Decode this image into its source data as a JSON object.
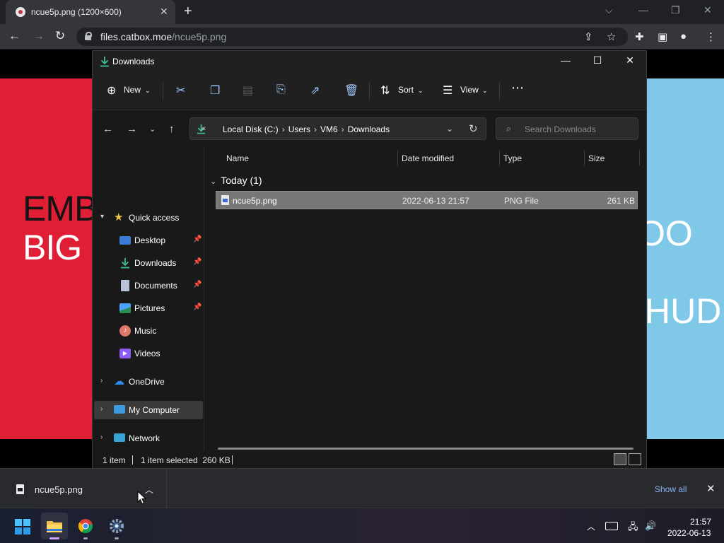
{
  "browser": {
    "tab_title": "ncue5p.png (1200×600)",
    "url_host": "files.catbox.moe",
    "url_path": "/ncue5p.png"
  },
  "page_image": {
    "left_line1": "EMB",
    "left_line2": "BIG",
    "right_line1": "OO",
    "right_line2": "HUD"
  },
  "explorer": {
    "title": "Downloads",
    "commands": {
      "new": "New",
      "sort": "Sort",
      "view": "View"
    },
    "breadcrumb": [
      "Local Disk (C:)",
      "Users",
      "VM6",
      "Downloads"
    ],
    "search_placeholder": "Search Downloads",
    "nav": {
      "quick_access": "Quick access",
      "desktop": "Desktop",
      "downloads": "Downloads",
      "documents": "Documents",
      "pictures": "Pictures",
      "music": "Music",
      "videos": "Videos",
      "onedrive": "OneDrive",
      "my_computer": "My Computer",
      "network": "Network"
    },
    "columns": {
      "name": "Name",
      "date": "Date modified",
      "type": "Type",
      "size": "Size"
    },
    "group": "Today (1)",
    "files": [
      {
        "name": "ncue5p.png",
        "date": "2022-06-13 21:57",
        "type": "PNG File",
        "size": "261 KB"
      }
    ],
    "status": {
      "count": "1 item",
      "selection": "1 item selected  260 KB"
    }
  },
  "download_shelf": {
    "file": "ncue5p.png",
    "show_all": "Show all"
  },
  "taskbar": {
    "time": "21:57",
    "date": "2022-06-13"
  }
}
